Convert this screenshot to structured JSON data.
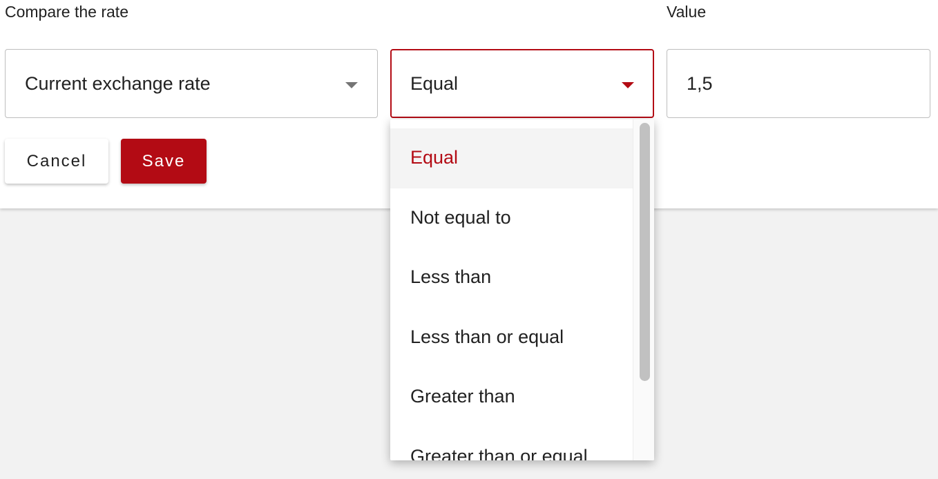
{
  "labels": {
    "compare": "Compare the rate",
    "value": "Value"
  },
  "fields": {
    "rate_select": "Current exchange rate",
    "operator_select": "Equal",
    "value_input": "1,5"
  },
  "buttons": {
    "cancel": "Cancel",
    "save": "Save"
  },
  "operator_menu": {
    "items": [
      {
        "label": "Equal",
        "selected": true
      },
      {
        "label": "Not equal to"
      },
      {
        "label": "Less than"
      },
      {
        "label": "Less than or equal"
      },
      {
        "label": "Greater than"
      },
      {
        "label": "Greater than or equal"
      }
    ]
  },
  "icons": {
    "dropdown": "caret-down-icon"
  },
  "colors": {
    "accent": "#b30b14",
    "background": "#f2f2f2",
    "panel": "#ffffff"
  }
}
